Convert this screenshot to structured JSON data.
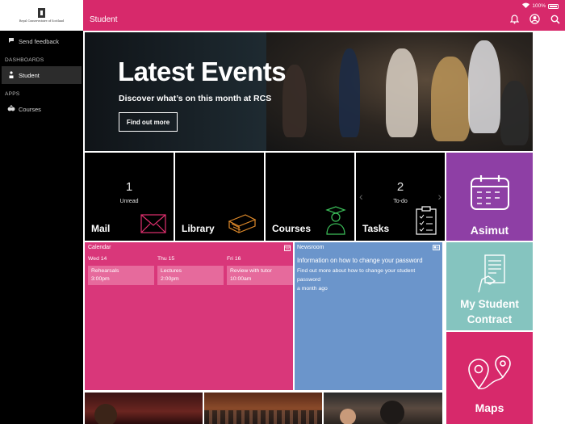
{
  "status_bar": {
    "battery": "100%"
  },
  "sidebar": {
    "logo_text": "Royal Conservatoire of Scotland",
    "feedback_label": "Send feedback",
    "sections": [
      {
        "title": "DASHBOARDS",
        "items": [
          {
            "label": "Student",
            "icon": "person-icon",
            "active": true
          }
        ]
      },
      {
        "title": "APPS",
        "items": [
          {
            "label": "Courses",
            "icon": "courses-icon",
            "active": false
          }
        ]
      }
    ]
  },
  "header": {
    "title": "Student",
    "icons": [
      "bell-icon",
      "account-icon",
      "search-icon"
    ]
  },
  "hero": {
    "title": "Latest Events",
    "subtitle": "Discover what’s on this month at RCS",
    "button": "Find out more"
  },
  "tiles": {
    "mail": {
      "label": "Mail",
      "count": "1",
      "sub": "Unread"
    },
    "library": {
      "label": "Library"
    },
    "courses": {
      "label": "Courses"
    },
    "tasks": {
      "label": "Tasks",
      "count": "2",
      "sub": "To-do"
    },
    "asimut": {
      "label": "Asimut"
    },
    "contract": {
      "label_line1": "My Student",
      "label_line2": "Contract"
    },
    "maps": {
      "label": "Maps"
    }
  },
  "calendar": {
    "title": "Calendar",
    "days": [
      {
        "day": "Wed 14",
        "event": "Rehearsals",
        "time": "3:00pm"
      },
      {
        "day": "Thu 15",
        "event": "Lectures",
        "time": "2:00pm"
      },
      {
        "day": "Fri 16",
        "event": "Review with tutor",
        "time": "10:00am"
      }
    ]
  },
  "newsroom": {
    "title": "Newsroom",
    "headline": "Information on how to change your password",
    "body": "Find out more about how to change your student password",
    "time": "a month ago"
  },
  "colors": {
    "brand_pink": "#d7296b",
    "purple": "#8e3fa5",
    "teal": "#85c4bf",
    "news_blue": "#6b95cb"
  }
}
